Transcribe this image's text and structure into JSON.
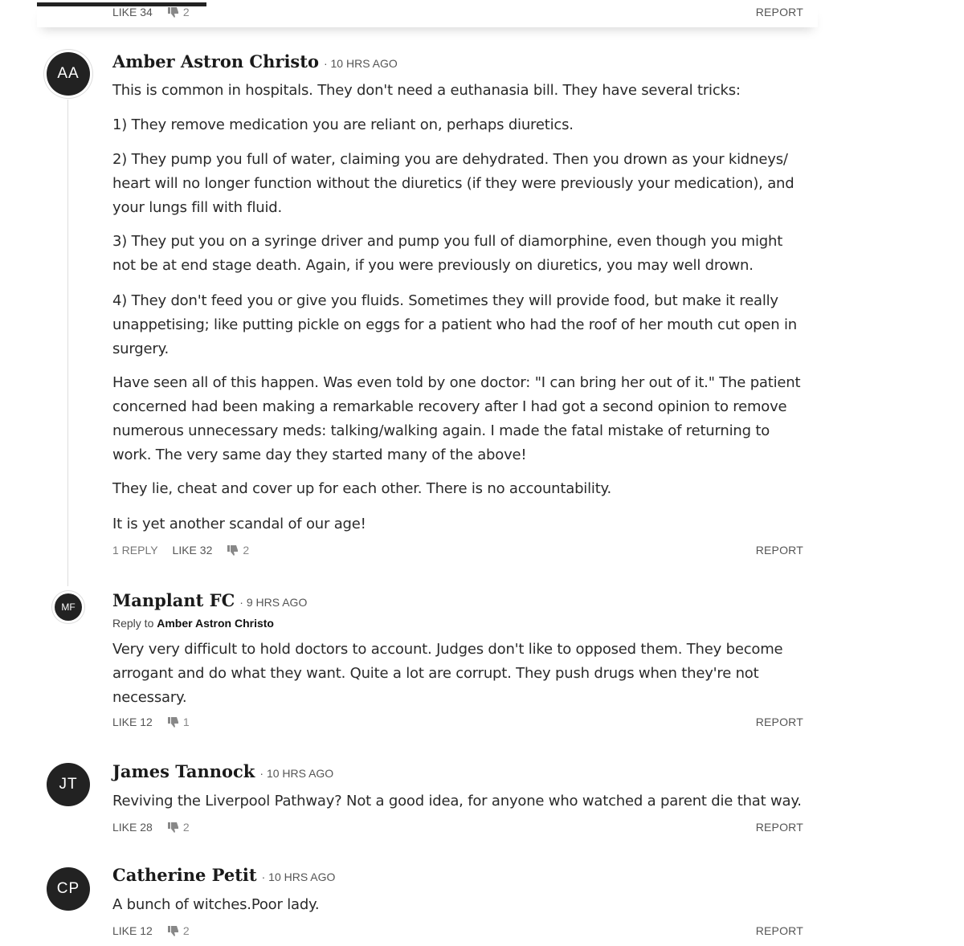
{
  "comments": [
    {
      "actions": {
        "like": "LIKE 34",
        "dislike": "2",
        "report": "REPORT"
      }
    },
    {
      "initials": "AA",
      "author": "Amber Astron Christo",
      "time": "10 HRS AGO",
      "paragraphs": [
        "This is common in hospitals. They don't need a euthanasia bill. They have several tricks:",
        "1) They remove medication you are reliant on, perhaps diuretics.",
        "2) They pump you full of water, claiming you are dehydrated. Then you drown as your kidneys/ heart will no longer function without the diuretics (if they were previously your medication), and your lungs fill with fluid.",
        "3) They put you on a syringe driver and pump you full of diamorphine, even though you might not be at end stage death. Again, if you were previously on diuretics, you may well drown.",
        "4) They don't feed you or give you fluids. Sometimes they will provide food, but make it really unappetising; like putting pickle on eggs for a patient who had the roof of her mouth cut open in surgery.",
        "Have seen all of this happen. Was even told by one doctor: \"I can bring her out of it.\" The patient concerned had been making a remarkable recovery after I had got a second opinion to remove numerous unnecessary meds: talking/walking again. I made the fatal mistake of returning to work. The very same day they started many of the above!",
        "They lie, cheat and cover up for each other. There is no accountability.",
        "It is yet another scandal of our age!"
      ],
      "actions": {
        "reply": "1 REPLY",
        "like": "LIKE 32",
        "dislike": "2",
        "report": "REPORT"
      }
    },
    {
      "initials": "MF",
      "author": "Manplant FC",
      "time": "9 HRS AGO",
      "reply_to_label": "Reply to",
      "reply_to": "Amber Astron Christo",
      "paragraphs": [
        "Very very difficult to hold doctors to account. Judges don't like to opposed them. They become arrogant and do what they want. Quite a lot are corrupt. They push drugs when they're not necessary."
      ],
      "actions": {
        "like": "LIKE 12",
        "dislike": "1",
        "report": "REPORT"
      }
    },
    {
      "initials": "JT",
      "author": "James Tannock",
      "time": "10 HRS AGO",
      "paragraphs": [
        "Reviving the Liverpool Pathway? Not a good idea, for anyone who watched a parent die that way."
      ],
      "actions": {
        "like": "LIKE 28",
        "dislike": "2",
        "report": "REPORT"
      }
    },
    {
      "initials": "CP",
      "author": "Catherine Petit",
      "time": "10 HRS AGO",
      "paragraphs": [
        "A bunch of witches.Poor lady."
      ],
      "actions": {
        "like": "LIKE 12",
        "dislike": "2",
        "report": "REPORT"
      }
    }
  ],
  "icons": {
    "dislike": "thumbs-down-icon"
  },
  "colors": {
    "avatar_bg": "#222222",
    "text": "#2a2a2a",
    "meta": "#555555"
  }
}
